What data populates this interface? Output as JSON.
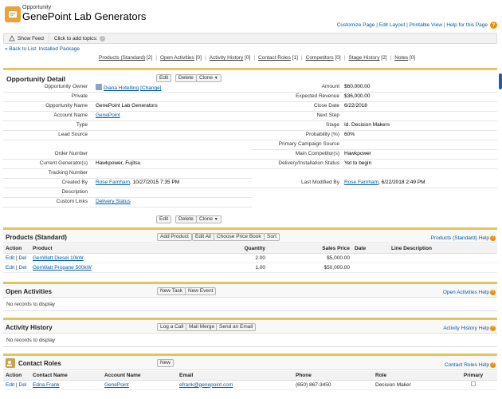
{
  "header": {
    "subtitle": "Opportunity",
    "title": "GenePoint Lab Generators",
    "links": [
      "Customize Page",
      "Edit Layout",
      "Printable View",
      "Help for this Page"
    ],
    "help_icon": "?"
  },
  "feed": {
    "show_feed": "Show Feed",
    "topics": "Click to add topics:"
  },
  "back_link": "« Back to List: Installed Package",
  "related": [
    {
      "label": "Products (Standard)",
      "count": "[2]"
    },
    {
      "label": "Open Activities",
      "count": "[0]"
    },
    {
      "label": "Activity History",
      "count": "[0]"
    },
    {
      "label": "Contact Roles",
      "count": "[1]"
    },
    {
      "label": "Competitors",
      "count": "[0]"
    },
    {
      "label": "Stage History",
      "count": "[2]"
    },
    {
      "label": "Notes",
      "count": "[0]"
    }
  ],
  "detail": {
    "title": "Opportunity Detail",
    "buttons": {
      "edit": "Edit",
      "delete": "Delete",
      "clone": "Clone"
    },
    "left": [
      {
        "label": "Opportunity Owner",
        "value": "Diana Hotelling",
        "extra": "[Change]"
      },
      {
        "label": "Private",
        "value": ""
      },
      {
        "label": "Opportunity Name",
        "value": "GenePoint Lab Generators"
      },
      {
        "label": "Account Name",
        "value": "GenePoint"
      },
      {
        "label": "Type",
        "value": ""
      },
      {
        "label": "Lead Source",
        "value": ""
      },
      {
        "label": "Order Number",
        "value": ""
      },
      {
        "label": "Current Generator(s)",
        "value": "Hawkpower, Fujitsu"
      },
      {
        "label": "Tracking Number",
        "value": ""
      },
      {
        "label": "Created By",
        "value": "Rose Farnham",
        "extra": ", 10/27/2015 7:35 PM"
      },
      {
        "label": "Description",
        "value": ""
      },
      {
        "label": "Custom Links",
        "value": "Delivery Status"
      }
    ],
    "right": [
      {
        "label": "Amount",
        "value": "$60,000.00"
      },
      {
        "label": "Expected Revenue",
        "value": "$36,000.00"
      },
      {
        "label": "Close Date",
        "value": "6/22/2018"
      },
      {
        "label": "Next Step",
        "value": ""
      },
      {
        "label": "Stage",
        "value": "Id. Decision Makers"
      },
      {
        "label": "Probability (%)",
        "value": "60%"
      },
      {
        "label": "Primary Campaign Source",
        "value": ""
      },
      {
        "label": "Main Competitor(s)",
        "value": "Hawkpower"
      },
      {
        "label": "Delivery/Installation Status",
        "value": "Yet to begin"
      },
      {
        "label": "Last Modified By",
        "value": "Rose Farnham",
        "extra": ", 6/22/2018 2:49 PM"
      }
    ]
  },
  "products": {
    "title": "Products (Standard)",
    "buttons": [
      "Add Product",
      "Edit All",
      "Choose Price Book",
      "Sort"
    ],
    "help": "Products (Standard) Help",
    "columns": [
      "Action",
      "Product",
      "Quantity",
      "Sales Price",
      "Date",
      "Line Description"
    ],
    "rows": [
      {
        "edit": "Edit",
        "del": "Del",
        "product": "GenWatt Diesel 10kW",
        "qty": "2.00",
        "price": "$5,000.00",
        "date": "",
        "desc": ""
      },
      {
        "edit": "Edit",
        "del": "Del",
        "product": "GenWatt Propane 500kW",
        "qty": "1.00",
        "price": "$50,000.00",
        "date": "",
        "desc": ""
      }
    ]
  },
  "open_activities": {
    "title": "Open Activities",
    "buttons": [
      "New Task",
      "New Event"
    ],
    "help": "Open Activities Help",
    "empty": "No records to display"
  },
  "activity_history": {
    "title": "Activity History",
    "buttons": [
      "Log a Call",
      "Mail Merge",
      "Send an Email"
    ],
    "help": "Activity History Help",
    "empty": "No records to display"
  },
  "contact_roles": {
    "title": "Contact Roles",
    "buttons": [
      "New"
    ],
    "help": "Contact Roles Help",
    "columns": [
      "Action",
      "Contact Name",
      "Account Name",
      "Email",
      "Phone",
      "Role",
      "Primary"
    ],
    "rows": [
      {
        "edit": "Edit",
        "del": "Del",
        "contact": "Edna Frank",
        "account": "GenePoint",
        "email": "efrank@genepoint.com",
        "phone": "(650) 867-3450",
        "role": "Decision Maker"
      }
    ]
  }
}
